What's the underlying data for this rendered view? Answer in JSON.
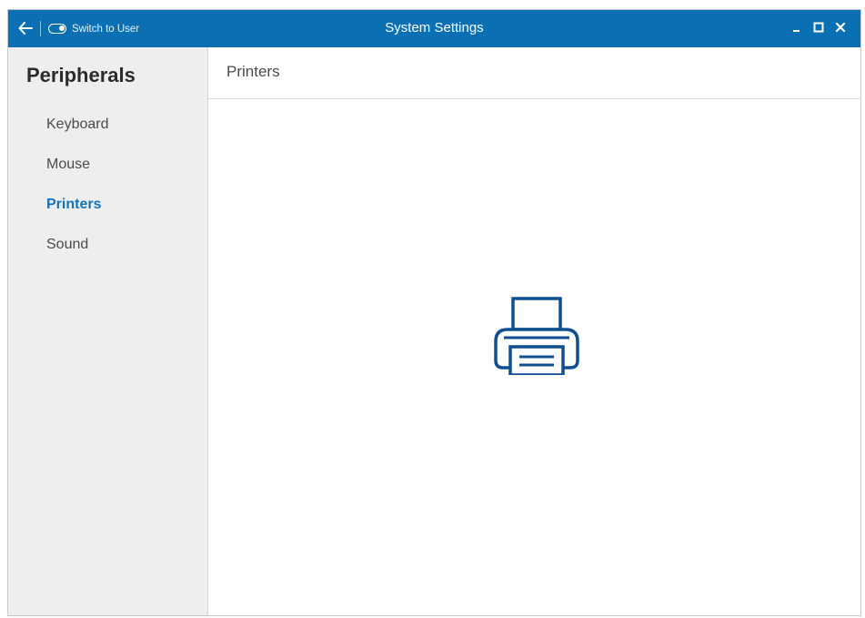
{
  "titlebar": {
    "title": "System Settings",
    "switch_label": "Switch to User",
    "back_icon": "arrow-left-icon",
    "controls": [
      "minimize-icon",
      "maximize-icon",
      "close-icon"
    ]
  },
  "sidebar": {
    "title": "Peripherals",
    "items": [
      {
        "label": "Keyboard",
        "active": false
      },
      {
        "label": "Mouse",
        "active": false
      },
      {
        "label": "Printers",
        "active": true
      },
      {
        "label": "Sound",
        "active": false
      }
    ]
  },
  "main": {
    "title": "Printers",
    "icon": "printer-icon"
  },
  "colors": {
    "titlebar": "#0b6fb3",
    "accent": "#1572b8",
    "icon": "#0e4f8f",
    "sidebar_bg": "#eeeeee"
  }
}
